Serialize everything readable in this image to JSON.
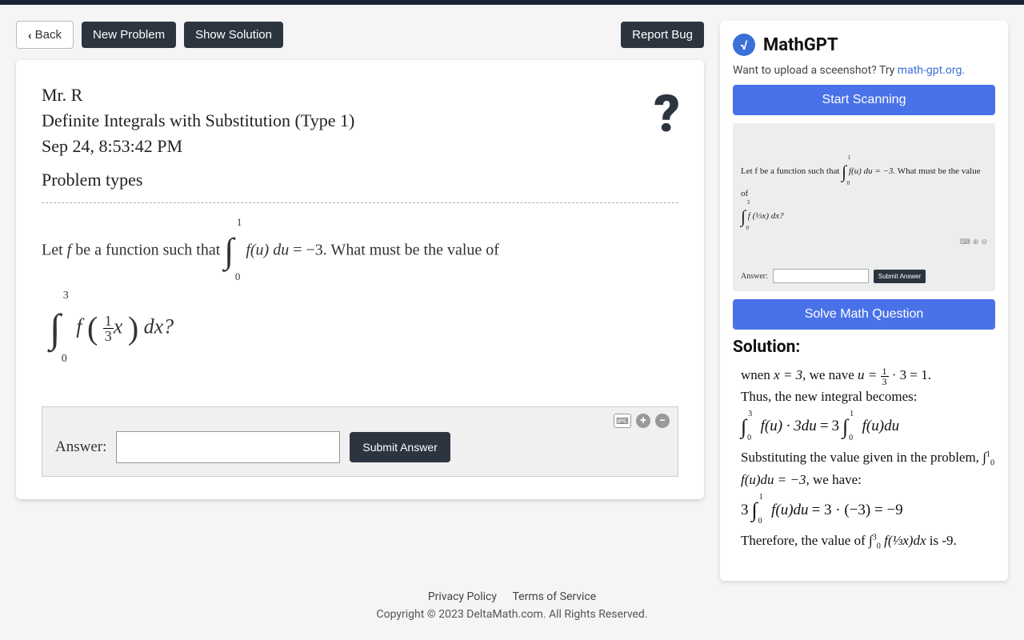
{
  "toolbar": {
    "back": "Back",
    "new_problem": "New Problem",
    "show_solution": "Show Solution",
    "report_bug": "Report Bug"
  },
  "header": {
    "teacher": "Mr. R",
    "topic": "Definite Integrals with Substitution (Type 1)",
    "timestamp": "Sep 24, 8:53:42 PM",
    "problem_types": "Problem types"
  },
  "problem": {
    "prefix": "Let ",
    "var_f": "f",
    "mid1": " be a function such that ",
    "integral_lhs": "∫",
    "bounds1_low": "0",
    "bounds1_high": "1",
    "integrand1": "f(u) du",
    "equals": " = ",
    "rhs1": "−3",
    "mid2": ". What must be the value of",
    "line2_integral": "∫",
    "bounds2_low": "0",
    "bounds2_high": "3",
    "integrand2_pre": "f ",
    "frac_num": "1",
    "frac_den": "3",
    "integrand2_post": "x",
    "dx": " dx?",
    "lparen": "(",
    "rparen": ")"
  },
  "answer_area": {
    "label": "Answer:",
    "submit": "Submit Answer"
  },
  "mathgpt": {
    "brand": "MathGPT",
    "upload_prefix": "Want to upload a sceenshot? Try ",
    "upload_link": "math-gpt.org",
    "upload_suffix": ".",
    "start_scanning": "Start Scanning",
    "solve": "Solve Math Question",
    "preview_text_1": "Let f be a function such that ",
    "preview_int1": "∫",
    "preview_b1l": "0",
    "preview_b1h": "1",
    "preview_integrand1": " f(u) du = −3.",
    "preview_mid": " What must be the value of",
    "preview_int2": "∫",
    "preview_b2l": "0",
    "preview_b2h": "3",
    "preview_integrand2": " f (⅓x) dx?",
    "preview_answer_label": "Answer:",
    "preview_submit": "Submit Answer"
  },
  "solution": {
    "heading": "Solution:",
    "line1_a": "wnen ",
    "line1_b": "x = 3",
    "line1_c": ", we nave ",
    "line1_d": "u = ",
    "line1_frac_n": "1",
    "line1_frac_d": "3",
    "line1_e": " · 3 = 1.",
    "line2": "Thus, the new integral becomes:",
    "eq1_lhs_int": "∫",
    "eq1_lhs_low": "0",
    "eq1_lhs_high": "3",
    "eq1_lhs_body": "f(u) · 3du",
    "eq1_eq": " = ",
    "eq1_rhs_coef": "3",
    "eq1_rhs_int": "∫",
    "eq1_rhs_low": "0",
    "eq1_rhs_high": "1",
    "eq1_rhs_body": "f(u)du",
    "line3_a": "Substituting the value given in the problem, ",
    "line3_int": "∫",
    "line3_low": "0",
    "line3_high": "1",
    "line3_body": " f(u)du = −3",
    "line3_b": ", we have:",
    "eq2_lhs_coef": "3",
    "eq2_lhs_int": "∫",
    "eq2_lhs_low": "0",
    "eq2_lhs_high": "1",
    "eq2_lhs_body": "f(u)du",
    "eq2_mid": " = 3 · (−3) = −9",
    "line4_a": "Therefore, the value of ",
    "line4_int": "∫",
    "line4_low": "0",
    "line4_high": "3",
    "line4_body": " f(⅓x)dx",
    "line4_b": " is -9."
  },
  "footer": {
    "privacy": "Privacy Policy",
    "terms": "Terms of Service",
    "copyright": "Copyright © 2023 DeltaMath.com. All Rights Reserved."
  }
}
